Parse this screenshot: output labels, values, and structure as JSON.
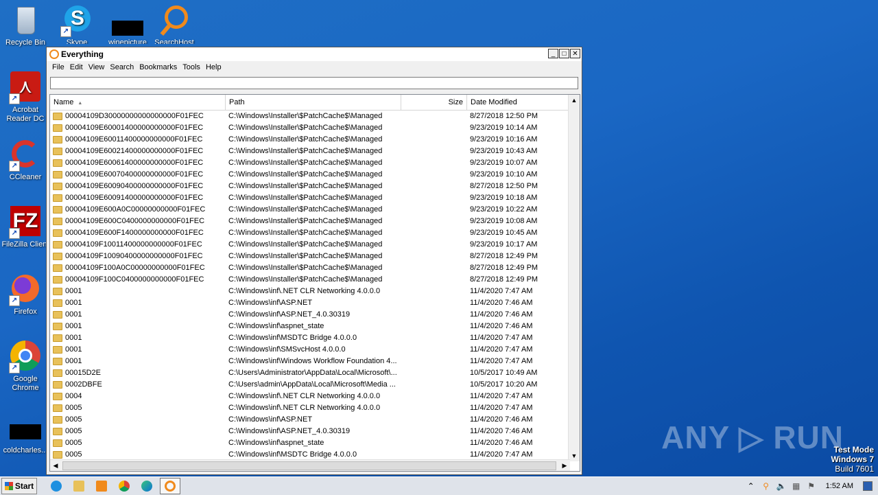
{
  "desktop": {
    "icons": [
      {
        "label": "Recycle Bin"
      },
      {
        "label": "Skype"
      },
      {
        "label": "winepicture"
      },
      {
        "label": "SearchHost"
      },
      {
        "label": "Acrobat Reader DC"
      },
      {
        "label": "CCleaner"
      },
      {
        "label": "FileZilla Client"
      },
      {
        "label": "Firefox"
      },
      {
        "label": "Google Chrome"
      },
      {
        "label": "coldcharles..."
      }
    ],
    "watermark": "ANY ▷ RUN",
    "test_mode": {
      "line1": "Test Mode",
      "line2": "Windows 7",
      "line3": "Build 7601"
    }
  },
  "window": {
    "title": "Everything",
    "menu": [
      "File",
      "Edit",
      "View",
      "Search",
      "Bookmarks",
      "Tools",
      "Help"
    ],
    "search_value": "",
    "columns": {
      "name": "Name",
      "path": "Path",
      "size": "Size",
      "date": "Date Modified"
    },
    "rows": [
      {
        "name": "00004109D30000000000000000F01FEC",
        "path": "C:\\Windows\\Installer\\$PatchCache$\\Managed",
        "size": "",
        "date": "8/27/2018 12:50 PM"
      },
      {
        "name": "00004109E60001400000000000F01FEC",
        "path": "C:\\Windows\\Installer\\$PatchCache$\\Managed",
        "size": "",
        "date": "9/23/2019 10:14 AM"
      },
      {
        "name": "00004109E60011400000000000F01FEC",
        "path": "C:\\Windows\\Installer\\$PatchCache$\\Managed",
        "size": "",
        "date": "9/23/2019 10:16 AM"
      },
      {
        "name": "00004109E60021400000000000F01FEC",
        "path": "C:\\Windows\\Installer\\$PatchCache$\\Managed",
        "size": "",
        "date": "9/23/2019 10:43 AM"
      },
      {
        "name": "00004109E60061400000000000F01FEC",
        "path": "C:\\Windows\\Installer\\$PatchCache$\\Managed",
        "size": "",
        "date": "9/23/2019 10:07 AM"
      },
      {
        "name": "00004109E60070400000000000F01FEC",
        "path": "C:\\Windows\\Installer\\$PatchCache$\\Managed",
        "size": "",
        "date": "9/23/2019 10:10 AM"
      },
      {
        "name": "00004109E60090400000000000F01FEC",
        "path": "C:\\Windows\\Installer\\$PatchCache$\\Managed",
        "size": "",
        "date": "8/27/2018 12:50 PM"
      },
      {
        "name": "00004109E60091400000000000F01FEC",
        "path": "C:\\Windows\\Installer\\$PatchCache$\\Managed",
        "size": "",
        "date": "9/23/2019 10:18 AM"
      },
      {
        "name": "00004109E600A0C00000000000F01FEC",
        "path": "C:\\Windows\\Installer\\$PatchCache$\\Managed",
        "size": "",
        "date": "9/23/2019 10:22 AM"
      },
      {
        "name": "00004109E600C0400000000000F01FEC",
        "path": "C:\\Windows\\Installer\\$PatchCache$\\Managed",
        "size": "",
        "date": "9/23/2019 10:08 AM"
      },
      {
        "name": "00004109E600F1400000000000F01FEC",
        "path": "C:\\Windows\\Installer\\$PatchCache$\\Managed",
        "size": "",
        "date": "9/23/2019 10:45 AM"
      },
      {
        "name": "00004109F10011400000000000F01FEC",
        "path": "C:\\Windows\\Installer\\$PatchCache$\\Managed",
        "size": "",
        "date": "9/23/2019 10:17 AM"
      },
      {
        "name": "00004109F10090400000000000F01FEC",
        "path": "C:\\Windows\\Installer\\$PatchCache$\\Managed",
        "size": "",
        "date": "8/27/2018 12:49 PM"
      },
      {
        "name": "00004109F100A0C00000000000F01FEC",
        "path": "C:\\Windows\\Installer\\$PatchCache$\\Managed",
        "size": "",
        "date": "8/27/2018 12:49 PM"
      },
      {
        "name": "00004109F100C0400000000000F01FEC",
        "path": "C:\\Windows\\Installer\\$PatchCache$\\Managed",
        "size": "",
        "date": "8/27/2018 12:49 PM"
      },
      {
        "name": "0001",
        "path": "C:\\Windows\\inf\\.NET CLR Networking 4.0.0.0",
        "size": "",
        "date": "11/4/2020 7:47 AM"
      },
      {
        "name": "0001",
        "path": "C:\\Windows\\inf\\ASP.NET",
        "size": "",
        "date": "11/4/2020 7:46 AM"
      },
      {
        "name": "0001",
        "path": "C:\\Windows\\inf\\ASP.NET_4.0.30319",
        "size": "",
        "date": "11/4/2020 7:46 AM"
      },
      {
        "name": "0001",
        "path": "C:\\Windows\\inf\\aspnet_state",
        "size": "",
        "date": "11/4/2020 7:46 AM"
      },
      {
        "name": "0001",
        "path": "C:\\Windows\\inf\\MSDTC Bridge 4.0.0.0",
        "size": "",
        "date": "11/4/2020 7:47 AM"
      },
      {
        "name": "0001",
        "path": "C:\\Windows\\inf\\SMSvcHost 4.0.0.0",
        "size": "",
        "date": "11/4/2020 7:47 AM"
      },
      {
        "name": "0001",
        "path": "C:\\Windows\\inf\\Windows Workflow Foundation 4...",
        "size": "",
        "date": "11/4/2020 7:47 AM"
      },
      {
        "name": "00015D2E",
        "path": "C:\\Users\\Administrator\\AppData\\Local\\Microsoft\\...",
        "size": "",
        "date": "10/5/2017 10:49 AM"
      },
      {
        "name": "0002DBFE",
        "path": "C:\\Users\\admin\\AppData\\Local\\Microsoft\\Media ...",
        "size": "",
        "date": "10/5/2017 10:20 AM"
      },
      {
        "name": "0004",
        "path": "C:\\Windows\\inf\\.NET CLR Networking 4.0.0.0",
        "size": "",
        "date": "11/4/2020 7:47 AM"
      },
      {
        "name": "0005",
        "path": "C:\\Windows\\inf\\.NET CLR Networking 4.0.0.0",
        "size": "",
        "date": "11/4/2020 7:47 AM"
      },
      {
        "name": "0005",
        "path": "C:\\Windows\\inf\\ASP.NET",
        "size": "",
        "date": "11/4/2020 7:46 AM"
      },
      {
        "name": "0005",
        "path": "C:\\Windows\\inf\\ASP.NET_4.0.30319",
        "size": "",
        "date": "11/4/2020 7:46 AM"
      },
      {
        "name": "0005",
        "path": "C:\\Windows\\inf\\aspnet_state",
        "size": "",
        "date": "11/4/2020 7:46 AM"
      },
      {
        "name": "0005",
        "path": "C:\\Windows\\inf\\MSDTC Bridge 4.0.0.0",
        "size": "",
        "date": "11/4/2020 7:47 AM"
      }
    ]
  },
  "taskbar": {
    "start_label": "Start",
    "clock": "1:52 AM",
    "pinned": [
      "internet-explorer",
      "file-explorer",
      "media-player",
      "chrome",
      "edge",
      "everything"
    ]
  }
}
